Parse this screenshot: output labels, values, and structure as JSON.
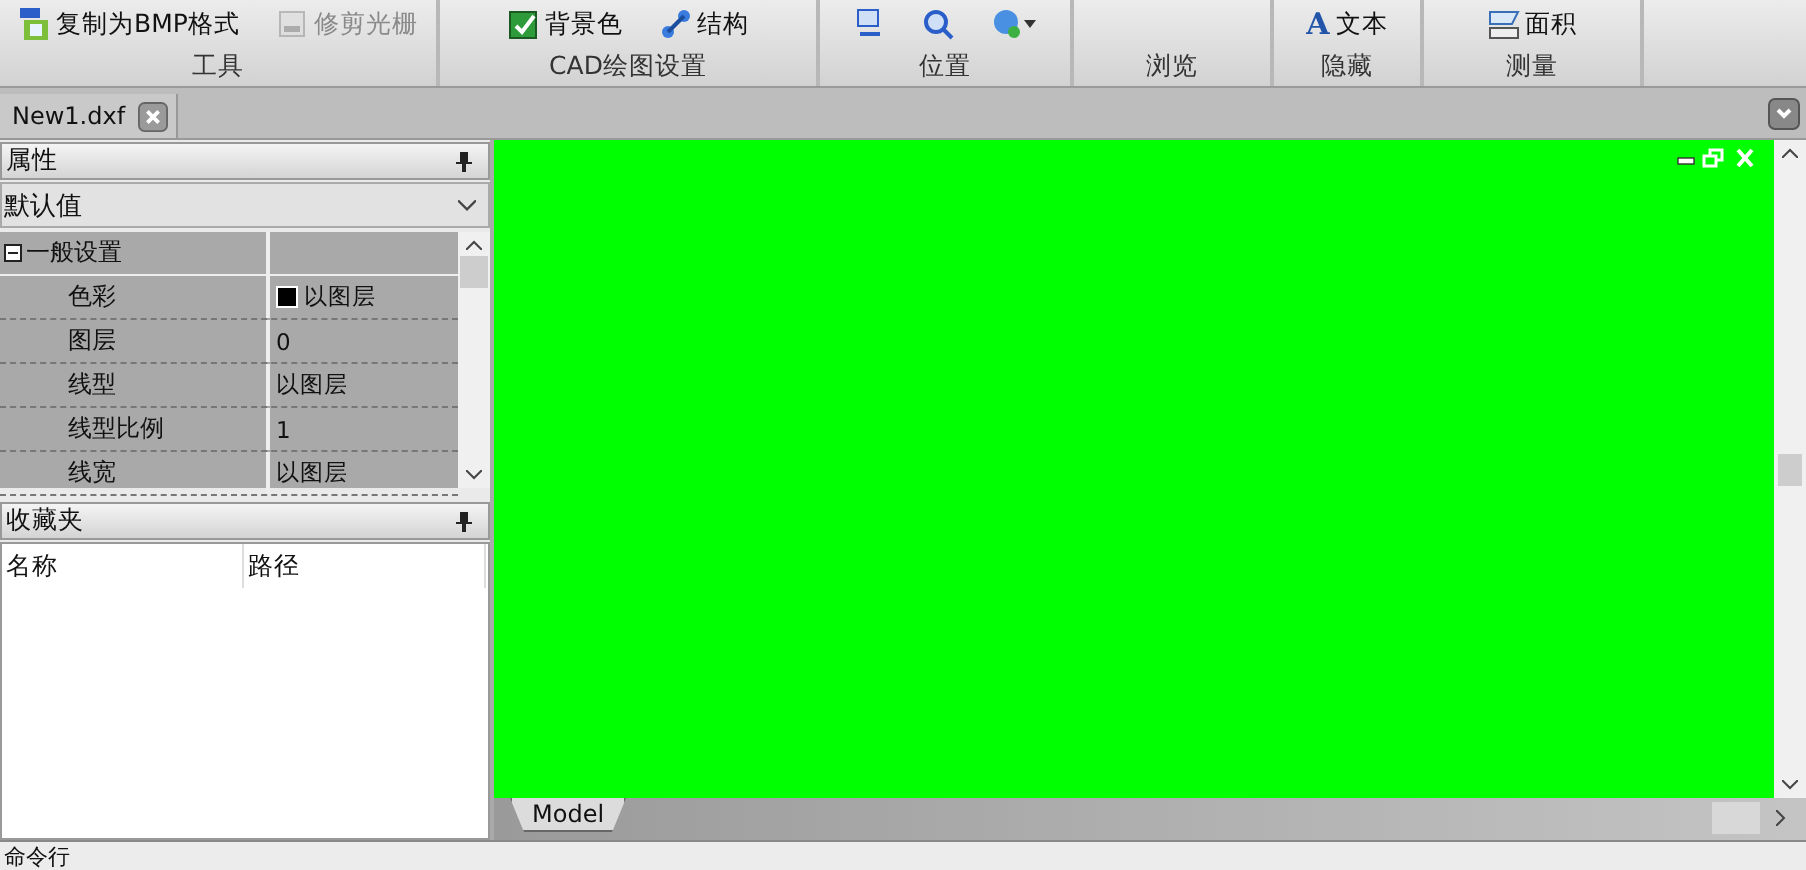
{
  "ribbon": {
    "groups": [
      {
        "label": "工具",
        "buttons": [
          {
            "kind": "text",
            "label": "复制为BMP格式",
            "disabled": false
          },
          {
            "kind": "text",
            "label": "修剪光栅",
            "disabled": true
          }
        ]
      },
      {
        "label": "CAD绘图设置",
        "buttons": [
          {
            "kind": "text",
            "label": "背景色",
            "disabled": false
          },
          {
            "kind": "text",
            "label": "结构",
            "disabled": false
          }
        ]
      },
      {
        "label": "位置",
        "buttons": [
          {
            "kind": "icon"
          },
          {
            "kind": "icon"
          },
          {
            "kind": "dropdown"
          }
        ]
      },
      {
        "label": "浏览"
      },
      {
        "label": "隐藏",
        "buttons": [
          {
            "kind": "glyph",
            "glyph": "A",
            "label": "文本",
            "disabled": false
          }
        ]
      },
      {
        "label": "测量",
        "buttons": [
          {
            "kind": "text",
            "label": "面积",
            "disabled": false
          }
        ]
      }
    ]
  },
  "document_tabs": [
    {
      "label": "New1.dxf",
      "selected": true
    }
  ],
  "properties": {
    "title": "属性",
    "preset": "默认值",
    "section": {
      "label": "一般设置",
      "expanded": true
    },
    "rows": [
      {
        "name": "色彩",
        "value": "以图层",
        "color": "#000000"
      },
      {
        "name": "图层",
        "value": "0"
      },
      {
        "name": "线型",
        "value": "以图层"
      },
      {
        "name": "线型比例",
        "value": "1"
      },
      {
        "name": "线宽",
        "value": "以图层"
      }
    ]
  },
  "favorites": {
    "title": "收藏夹",
    "columns": [
      "名称",
      "路径"
    ]
  },
  "layout_tabs": [
    {
      "label": "Model",
      "selected": true
    }
  ],
  "command_line": {
    "label": "命令行"
  }
}
